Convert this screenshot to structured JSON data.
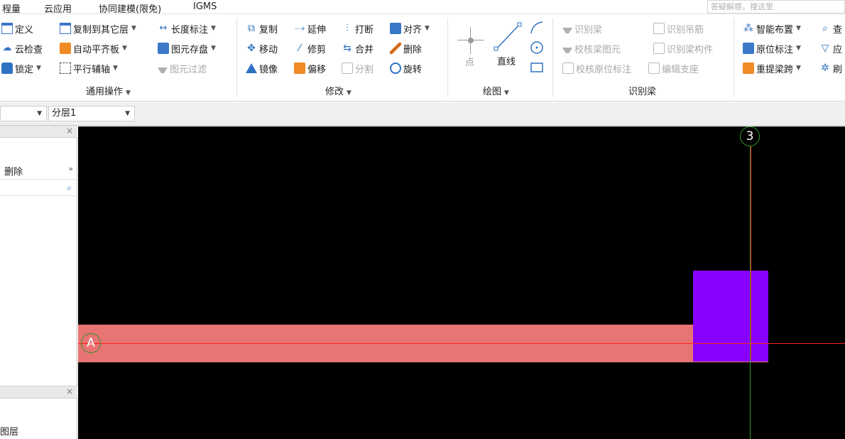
{
  "menubar": {
    "items": [
      "程量",
      "云应用",
      "协同建模(限免)",
      "IGMS"
    ],
    "search_placeholder": "答疑解惑，搜这里"
  },
  "ribbon": {
    "general": {
      "label": "通用操作",
      "buttons": [
        "定义",
        "复制到其它层",
        "长度标注",
        "云检查",
        "自动平齐板",
        "图元存盘",
        "锁定",
        "平行辅轴",
        "图元过滤"
      ]
    },
    "modify": {
      "label": "修改",
      "buttons": [
        "复制",
        "延伸",
        "打断",
        "对齐",
        "移动",
        "修剪",
        "合并",
        "删除",
        "镜像",
        "偏移",
        "分割",
        "旋转"
      ]
    },
    "draw": {
      "label": "绘图",
      "buttons": [
        "点",
        "直线"
      ]
    },
    "identify": {
      "label": "识别梁",
      "buttons": [
        "识别梁",
        "识别吊筋",
        "校核梁图元",
        "识别梁构件",
        "校核原位标注",
        "编辑支座"
      ]
    },
    "beam": {
      "buttons": [
        "智能布置",
        "查",
        "原位标注",
        "应",
        "重提梁跨",
        "刷"
      ]
    }
  },
  "layerbar": {
    "floor_value": "",
    "layer_value": "分层1"
  },
  "left_panel": {
    "delete_label": "删除",
    "bottom_label": "图层"
  },
  "canvas": {
    "axis_a": "A",
    "axis_3": "3"
  },
  "colors": {
    "canvas_bg": "#000000",
    "beam": "#e87474",
    "column": "#8800ff",
    "axis_line_red": "#ff2020",
    "axis_line_green": "#2b9a2b",
    "accent": "#2f72c4"
  }
}
